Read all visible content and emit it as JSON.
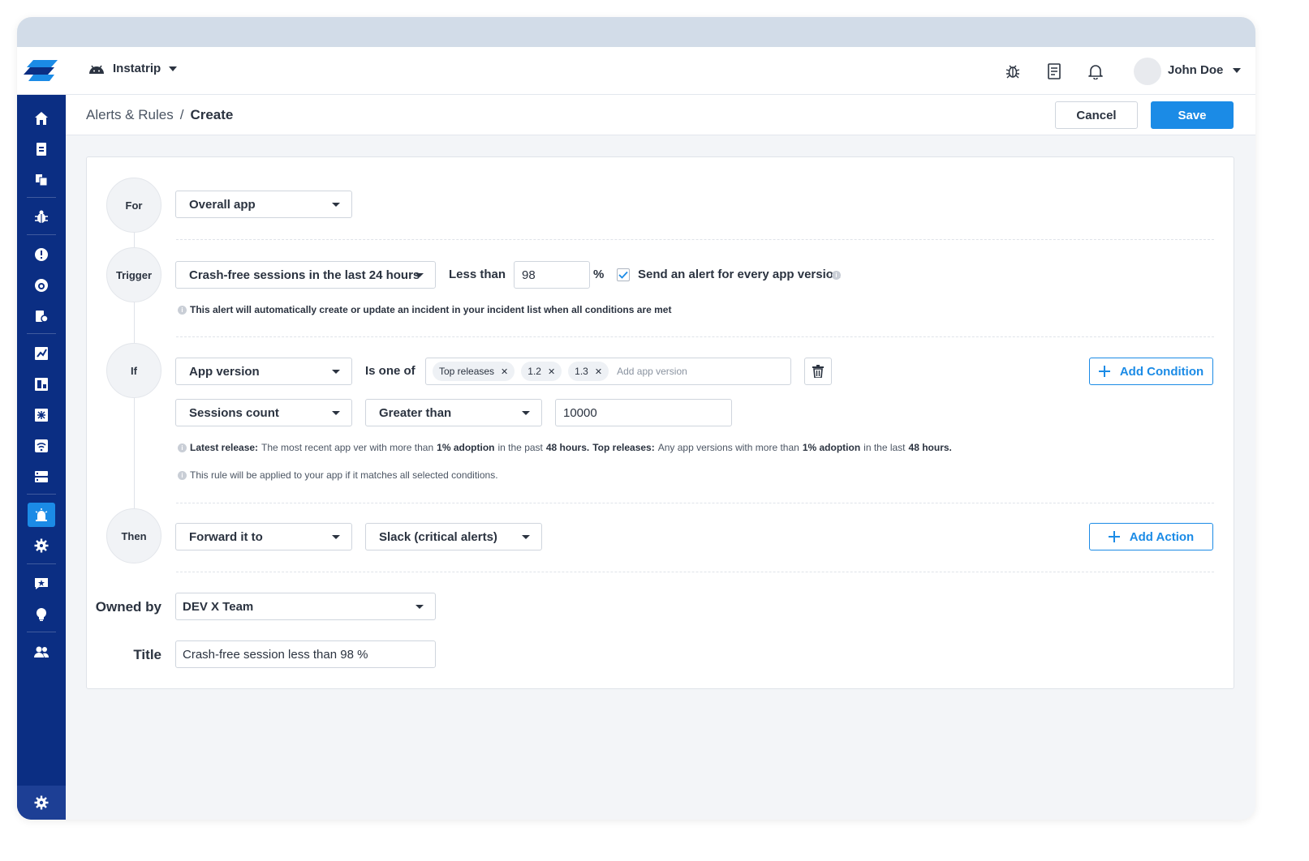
{
  "topbar": {
    "app_name": "Instatrip",
    "user_name": "John Doe"
  },
  "breadcrumb": {
    "parent": "Alerts & Rules",
    "separator": "/",
    "current": "Create"
  },
  "actions": {
    "cancel_label": "Cancel",
    "save_label": "Save"
  },
  "steps": {
    "for": "For",
    "trigger": "Trigger",
    "if": "If",
    "then": "Then"
  },
  "for_section": {
    "scope": "Overall app"
  },
  "trigger_section": {
    "metric": "Crash-free sessions in the last 24 hours",
    "operator": "Less than",
    "value": "98",
    "unit": "%",
    "every_version_label": "Send an alert for every app version",
    "every_version_checked": true,
    "note": "This alert will automatically create or update an incident in your incident list when all conditions are met"
  },
  "if_section": {
    "condition1_field": "App version",
    "condition1_operator": "Is one of",
    "condition1_tags": [
      "Top releases",
      "1.2",
      "1.3"
    ],
    "condition1_placeholder": "Add app version",
    "condition2_field": "Sessions count",
    "condition2_operator": "Greater than",
    "condition2_value": "10000",
    "add_condition_label": "Add Condition",
    "note1": {
      "latest_label": "Latest release:",
      "latest_text_1": "The most recent app ver with more than",
      "latest_bold_1": "1% adoption",
      "latest_text_2": "in the past",
      "latest_bold_2": "48 hours.",
      "top_label": "Top releases:",
      "top_text_1": "Any app versions with more than",
      "top_bold_1": "1% adoption",
      "top_text_2": "in the last",
      "top_bold_2": "48 hours."
    },
    "note2": "This rule will be applied to your app if it matches all selected conditions."
  },
  "then_section": {
    "action": "Forward it to",
    "destination": "Slack (critical alerts)",
    "add_action_label": "Add Action"
  },
  "owner": {
    "label": "Owned by",
    "value": "DEV X Team"
  },
  "title_field": {
    "label": "Title",
    "value": "Crash-free session less than 98 %"
  },
  "colors": {
    "sidebar": "#0b2e83",
    "accent": "#1b8be6",
    "titlebar": "#d2dce8",
    "background": "#f3f5f8"
  },
  "icons": {
    "sidebar": [
      "home-icon",
      "report-icon",
      "copy-icon",
      "bug-icon",
      "alert-circle-icon",
      "dashboard-icon",
      "tag-icon",
      "chart-icon",
      "layout-icon",
      "apm-icon",
      "network-icon",
      "storage-icon",
      "alarm-icon",
      "gear-icon",
      "feedback-icon",
      "bulb-icon",
      "users-icon",
      "settings-icon"
    ],
    "topbar": [
      "android-icon",
      "bug-report-icon",
      "docs-icon",
      "bell-icon"
    ]
  }
}
